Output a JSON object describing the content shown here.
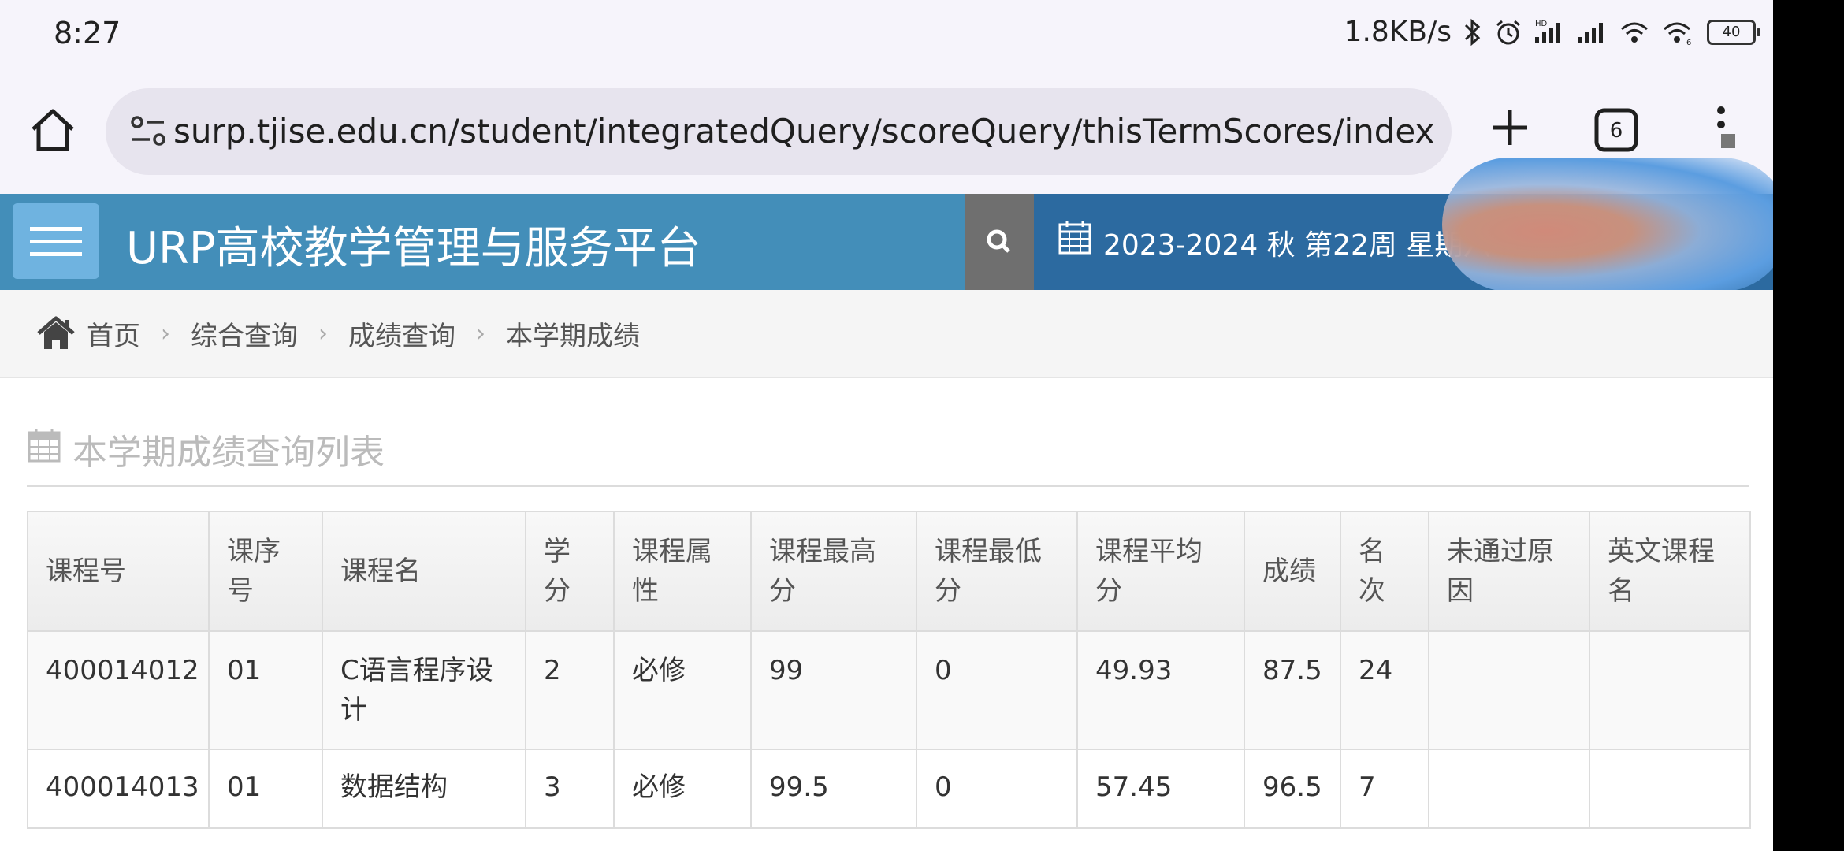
{
  "status_bar": {
    "time": "8:27",
    "network_speed": "1.8KB/s",
    "battery": "40",
    "icons": [
      "bluetooth-icon",
      "alarm-icon",
      "hd-signal-icon",
      "signal-icon",
      "wifi-icon",
      "wifi-6-icon",
      "battery-icon"
    ]
  },
  "browser": {
    "url": "surp.tjise.edu.cn/student/integratedQuery/scoreQuery/thisTermScores/index?m",
    "tab_count": "6"
  },
  "header": {
    "title": "URP高校教学管理与服务平台",
    "term": "2023-2024 秋 第22周 星期六"
  },
  "breadcrumb": {
    "items": [
      "首页",
      "综合查询",
      "成绩查询",
      "本学期成绩"
    ]
  },
  "section": {
    "title": "本学期成绩查询列表"
  },
  "table": {
    "columns": [
      "课程号",
      "课序号",
      "课程名",
      "学分",
      "课程属性",
      "课程最高分",
      "课程最低分",
      "课程平均分",
      "成绩",
      "名次",
      "未通过原因",
      "英文课程名"
    ],
    "rows": [
      [
        "400014012",
        "01",
        "C语言程序设计",
        "2",
        "必修",
        "99",
        "0",
        "49.93",
        "87.5",
        "24",
        "",
        ""
      ],
      [
        "400014013",
        "01",
        "数据结构",
        "3",
        "必修",
        "99.5",
        "0",
        "57.45",
        "96.5",
        "7",
        "",
        ""
      ]
    ]
  },
  "colors": {
    "header_bg": "#438eb9",
    "term_bg": "#2c6aa0",
    "hamburger_bg": "#6fb3e0"
  }
}
